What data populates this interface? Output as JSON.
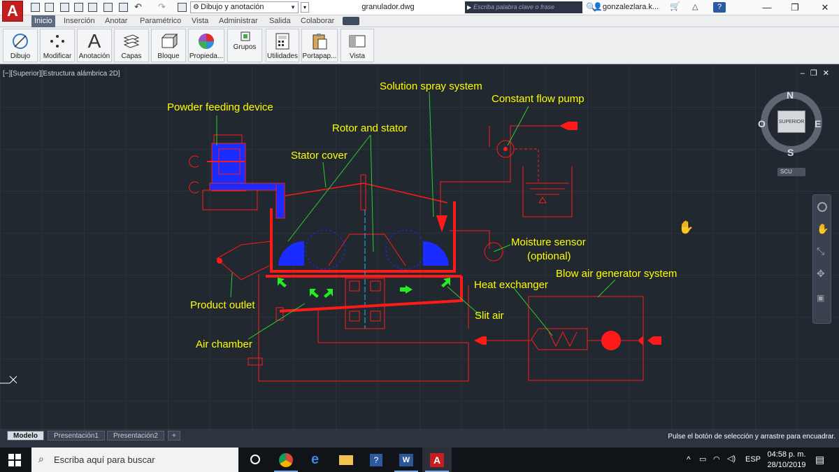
{
  "title_bar": {
    "app_logo": "A",
    "workspace": "Dibujo y anotación",
    "window_title": "granulador.dwg",
    "search_placeholder": "Escriba palabra clave o frase",
    "user": "gonzalezlara.k...",
    "controls": {
      "minimize": "—",
      "restore": "❐",
      "close": "✕"
    }
  },
  "menu": {
    "items": [
      "Inicio",
      "Inserción",
      "Anotar",
      "Paramétrico",
      "Vista",
      "Administrar",
      "Salida",
      "Colaborar"
    ],
    "active": "Inicio"
  },
  "ribbon": {
    "buttons": [
      {
        "label": "Dibujo",
        "icon": "draw-icon"
      },
      {
        "label": "Modificar",
        "icon": "modify-icon"
      },
      {
        "label": "Anotación",
        "icon": "annotation-icon"
      },
      {
        "label": "Capas",
        "icon": "layers-icon"
      },
      {
        "label": "Bloque",
        "icon": "block-icon"
      },
      {
        "label": "Propieda...",
        "icon": "properties-icon"
      },
      {
        "label": "Grupos",
        "icon": "groups-icon"
      },
      {
        "label": "Utilidades",
        "icon": "utilities-icon"
      },
      {
        "label": "Portapap...",
        "icon": "clipboard-icon"
      },
      {
        "label": "Vista",
        "icon": "view-icon"
      }
    ]
  },
  "canvas": {
    "viewport_label": "[−][Superior][Estructura alámbrica 2D]",
    "viewcube": {
      "north": "N",
      "south": "S",
      "east": "E",
      "west": "O",
      "face": "SUPERIOR",
      "ucs": "SCU"
    }
  },
  "diagram_labels": {
    "powder_feeding": "Powder feeding device",
    "rotor_stator": "Rotor and stator",
    "stator_cover": "Stator cover",
    "solution_spray": "Solution spray system",
    "constant_flow_pump": "Constant flow pump",
    "moisture_sensor_1": "Moisture sensor",
    "moisture_sensor_2": "(optional)",
    "blow_air": "Blow air generator system",
    "heat_exchanger": "Heat exchanger",
    "product_outlet": "Product outlet",
    "slit_air": "Slit air",
    "air_chamber": "Air chamber"
  },
  "layout_tabs": {
    "model": "Modelo",
    "layout1": "Presentación1",
    "layout2": "Presentación2",
    "add": "+"
  },
  "status_message": "Pulse el botón de selección y arrastre para encuadrar.",
  "taskbar": {
    "search_placeholder": "Escriba aquí para buscar",
    "language": "ESP",
    "time": "04:58 p. m.",
    "date": "28/10/2019"
  },
  "colors": {
    "line_red": "#ff1a1a",
    "label_yellow": "#ffff00",
    "leader_green": "#2ecc2e",
    "fill_blue": "#1a2cff",
    "bg": "#212830"
  }
}
